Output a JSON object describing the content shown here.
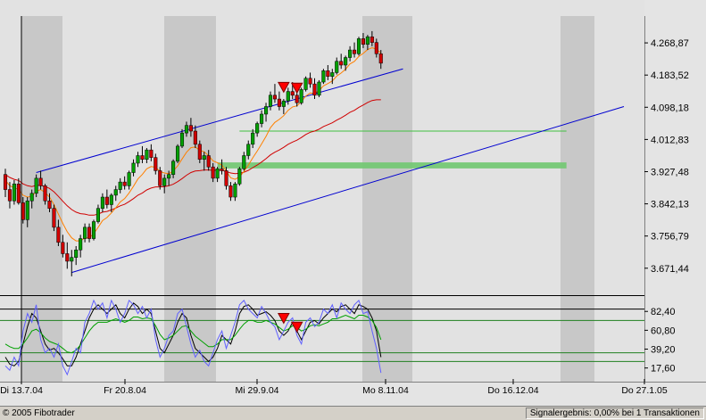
{
  "status": {
    "copyright": "© 2005 Fibotrader",
    "signal": "Signalergebnis: 0,00% bei 1 Transaktionen"
  },
  "chart_data": [
    {
      "type": "candlestick",
      "panel": "price",
      "title": "",
      "y_ticks": [
        "4.268,87",
        "4.183,52",
        "4.098,18",
        "4.012,83",
        "3.927,48",
        "3.842,13",
        "3.756,79",
        "3.671,44"
      ],
      "y_tick_values": [
        4268.87,
        4183.52,
        4098.18,
        4012.83,
        3927.48,
        3842.13,
        3756.79,
        3671.44
      ],
      "ylim": [
        3600,
        4340
      ],
      "x_ticks": [
        "Di 13.7.04",
        "Fr 20.8.04",
        "Mi 29.9.04",
        "Mo 8.11.04",
        "Do 16.12.04",
        "Do 27.1.05"
      ],
      "x_tick_index": [
        0,
        28,
        56,
        84,
        112,
        140
      ],
      "candles": [
        {
          "o": 3920,
          "h": 3935,
          "l": 3860,
          "c": 3880
        },
        {
          "o": 3880,
          "h": 3900,
          "l": 3830,
          "c": 3850
        },
        {
          "o": 3850,
          "h": 3905,
          "l": 3840,
          "c": 3895
        },
        {
          "o": 3895,
          "h": 3910,
          "l": 3840,
          "c": 3845
        },
        {
          "o": 3845,
          "h": 3860,
          "l": 3790,
          "c": 3800
        },
        {
          "o": 3800,
          "h": 3860,
          "l": 3780,
          "c": 3850
        },
        {
          "o": 3850,
          "h": 3880,
          "l": 3830,
          "c": 3870
        },
        {
          "o": 3870,
          "h": 3920,
          "l": 3860,
          "c": 3910
        },
        {
          "o": 3910,
          "h": 3930,
          "l": 3880,
          "c": 3890
        },
        {
          "o": 3890,
          "h": 3895,
          "l": 3840,
          "c": 3850
        },
        {
          "o": 3850,
          "h": 3870,
          "l": 3820,
          "c": 3830
        },
        {
          "o": 3830,
          "h": 3840,
          "l": 3770,
          "c": 3780
        },
        {
          "o": 3780,
          "h": 3800,
          "l": 3730,
          "c": 3740
        },
        {
          "o": 3740,
          "h": 3760,
          "l": 3700,
          "c": 3710
        },
        {
          "o": 3710,
          "h": 3740,
          "l": 3670,
          "c": 3690
        },
        {
          "o": 3690,
          "h": 3720,
          "l": 3650,
          "c": 3700
        },
        {
          "o": 3700,
          "h": 3730,
          "l": 3680,
          "c": 3720
        },
        {
          "o": 3720,
          "h": 3760,
          "l": 3700,
          "c": 3750
        },
        {
          "o": 3750,
          "h": 3790,
          "l": 3740,
          "c": 3780
        },
        {
          "o": 3780,
          "h": 3790,
          "l": 3740,
          "c": 3750
        },
        {
          "o": 3750,
          "h": 3800,
          "l": 3745,
          "c": 3795
        },
        {
          "o": 3795,
          "h": 3840,
          "l": 3790,
          "c": 3830
        },
        {
          "o": 3830,
          "h": 3870,
          "l": 3820,
          "c": 3860
        },
        {
          "o": 3860,
          "h": 3880,
          "l": 3830,
          "c": 3840
        },
        {
          "o": 3840,
          "h": 3870,
          "l": 3820,
          "c": 3865
        },
        {
          "o": 3865,
          "h": 3890,
          "l": 3850,
          "c": 3880
        },
        {
          "o": 3880,
          "h": 3910,
          "l": 3870,
          "c": 3900
        },
        {
          "o": 3900,
          "h": 3915,
          "l": 3880,
          "c": 3890
        },
        {
          "o": 3890,
          "h": 3930,
          "l": 3880,
          "c": 3925
        },
        {
          "o": 3925,
          "h": 3960,
          "l": 3915,
          "c": 3950
        },
        {
          "o": 3950,
          "h": 3980,
          "l": 3940,
          "c": 3970
        },
        {
          "o": 3970,
          "h": 3995,
          "l": 3950,
          "c": 3960
        },
        {
          "o": 3960,
          "h": 3990,
          "l": 3950,
          "c": 3985
        },
        {
          "o": 3985,
          "h": 4000,
          "l": 3955,
          "c": 3965
        },
        {
          "o": 3965,
          "h": 3975,
          "l": 3920,
          "c": 3930
        },
        {
          "o": 3930,
          "h": 3940,
          "l": 3880,
          "c": 3890
        },
        {
          "o": 3890,
          "h": 3920,
          "l": 3870,
          "c": 3910
        },
        {
          "o": 3910,
          "h": 3930,
          "l": 3890,
          "c": 3920
        },
        {
          "o": 3920,
          "h": 3960,
          "l": 3910,
          "c": 3955
        },
        {
          "o": 3955,
          "h": 4000,
          "l": 3950,
          "c": 3995
        },
        {
          "o": 3995,
          "h": 4040,
          "l": 3990,
          "c": 4030
        },
        {
          "o": 4030,
          "h": 4060,
          "l": 4020,
          "c": 4050
        },
        {
          "o": 4050,
          "h": 4070,
          "l": 4020,
          "c": 4035
        },
        {
          "o": 4035,
          "h": 4050,
          "l": 3990,
          "c": 4000
        },
        {
          "o": 4000,
          "h": 4010,
          "l": 3950,
          "c": 3960
        },
        {
          "o": 3960,
          "h": 3980,
          "l": 3930,
          "c": 3970
        },
        {
          "o": 3970,
          "h": 3985,
          "l": 3930,
          "c": 3940
        },
        {
          "o": 3940,
          "h": 3950,
          "l": 3900,
          "c": 3910
        },
        {
          "o": 3910,
          "h": 3940,
          "l": 3900,
          "c": 3935
        },
        {
          "o": 3935,
          "h": 3960,
          "l": 3920,
          "c": 3930
        },
        {
          "o": 3930,
          "h": 3940,
          "l": 3880,
          "c": 3890
        },
        {
          "o": 3890,
          "h": 3900,
          "l": 3850,
          "c": 3860
        },
        {
          "o": 3860,
          "h": 3900,
          "l": 3850,
          "c": 3895
        },
        {
          "o": 3895,
          "h": 3940,
          "l": 3890,
          "c": 3935
        },
        {
          "o": 3935,
          "h": 3980,
          "l": 3930,
          "c": 3970
        },
        {
          "o": 3970,
          "h": 4010,
          "l": 3960,
          "c": 4000
        },
        {
          "o": 4000,
          "h": 4040,
          "l": 3990,
          "c": 4030
        },
        {
          "o": 4030,
          "h": 4060,
          "l": 4020,
          "c": 4055
        },
        {
          "o": 4055,
          "h": 4090,
          "l": 4045,
          "c": 4080
        },
        {
          "o": 4080,
          "h": 4110,
          "l": 4060,
          "c": 4100
        },
        {
          "o": 4100,
          "h": 4140,
          "l": 4090,
          "c": 4130
        },
        {
          "o": 4130,
          "h": 4160,
          "l": 4110,
          "c": 4120
        },
        {
          "o": 4120,
          "h": 4140,
          "l": 4090,
          "c": 4100
        },
        {
          "o": 4100,
          "h": 4120,
          "l": 4080,
          "c": 4115
        },
        {
          "o": 4115,
          "h": 4150,
          "l": 4105,
          "c": 4140
        },
        {
          "o": 4140,
          "h": 4165,
          "l": 4120,
          "c": 4130
        },
        {
          "o": 4130,
          "h": 4150,
          "l": 4100,
          "c": 4110
        },
        {
          "o": 4110,
          "h": 4150,
          "l": 4105,
          "c": 4145
        },
        {
          "o": 4145,
          "h": 4180,
          "l": 4140,
          "c": 4175
        },
        {
          "o": 4175,
          "h": 4190,
          "l": 4150,
          "c": 4160
        },
        {
          "o": 4160,
          "h": 4175,
          "l": 4120,
          "c": 4130
        },
        {
          "o": 4130,
          "h": 4170,
          "l": 4125,
          "c": 4165
        },
        {
          "o": 4165,
          "h": 4200,
          "l": 4160,
          "c": 4195
        },
        {
          "o": 4195,
          "h": 4210,
          "l": 4170,
          "c": 4180
        },
        {
          "o": 4180,
          "h": 4200,
          "l": 4160,
          "c": 4190
        },
        {
          "o": 4190,
          "h": 4230,
          "l": 4185,
          "c": 4220
        },
        {
          "o": 4220,
          "h": 4240,
          "l": 4200,
          "c": 4210
        },
        {
          "o": 4210,
          "h": 4235,
          "l": 4195,
          "c": 4230
        },
        {
          "o": 4230,
          "h": 4260,
          "l": 4220,
          "c": 4250
        },
        {
          "o": 4250,
          "h": 4270,
          "l": 4230,
          "c": 4240
        },
        {
          "o": 4240,
          "h": 4285,
          "l": 4235,
          "c": 4280
        },
        {
          "o": 4280,
          "h": 4295,
          "l": 4255,
          "c": 4265
        },
        {
          "o": 4265,
          "h": 4290,
          "l": 4250,
          "c": 4285
        },
        {
          "o": 4285,
          "h": 4300,
          "l": 4260,
          "c": 4270
        },
        {
          "o": 4270,
          "h": 4280,
          "l": 4230,
          "c": 4240
        },
        {
          "o": 4240,
          "h": 4250,
          "l": 4200,
          "c": 4215
        }
      ],
      "indicators": {
        "ema_fast": [
          3905,
          3890,
          3885,
          3880,
          3865,
          3860,
          3862,
          3875,
          3880,
          3872,
          3860,
          3840,
          3815,
          3790,
          3768,
          3752,
          3744,
          3744,
          3752,
          3752,
          3763,
          3780,
          3798,
          3806,
          3818,
          3832,
          3847,
          3856,
          3871,
          3889,
          3908,
          3920,
          3935,
          3941,
          3939,
          3928,
          3924,
          3922,
          3929,
          3943,
          3961,
          3979,
          3991,
          3993,
          3984,
          3980,
          3970,
          3956,
          3951,
          3945,
          3929,
          3911,
          3907,
          3914,
          3928,
          3945,
          3964,
          3982,
          4001,
          4021,
          4044,
          4058,
          4066,
          4076,
          4090,
          4099,
          4102,
          4113,
          4128,
          4136,
          4135,
          4142,
          4155,
          4161,
          4168,
          4181,
          4189,
          4199,
          4213,
          4220,
          4233,
          4241,
          4251,
          4256,
          4252,
          4242
        ],
        "ema_slow": [
          3920,
          3912,
          3907,
          3904,
          3895,
          3890,
          3888,
          3891,
          3891,
          3888,
          3883,
          3874,
          3862,
          3849,
          3837,
          3827,
          3820,
          3816,
          3815,
          3812,
          3812,
          3815,
          3820,
          3822,
          3826,
          3831,
          3837,
          3841,
          3848,
          3856,
          3865,
          3871,
          3879,
          3884,
          3887,
          3887,
          3888,
          3890,
          3894,
          3901,
          3909,
          3918,
          3925,
          3929,
          3930,
          3932,
          3932,
          3931,
          3931,
          3931,
          3928,
          3924,
          3922,
          3923,
          3926,
          3931,
          3938,
          3945,
          3953,
          3962,
          3972,
          3979,
          3985,
          3992,
          4000,
          4006,
          4011,
          4018,
          4026,
          4032,
          4035,
          4040,
          4047,
          4052,
          4057,
          4064,
          4070,
          4077,
          4085,
          4090,
          4098,
          4104,
          4111,
          4116,
          4118,
          4118
        ]
      },
      "channel": {
        "upper": [
          [
            7,
            3925
          ],
          [
            90,
            4200
          ]
        ],
        "lower": [
          [
            15,
            3660
          ],
          [
            140,
            4100
          ]
        ]
      },
      "hlines": [
        {
          "y": 4035,
          "from": 53,
          "to": 127
        }
      ],
      "green_band": {
        "y_low": 3936,
        "y_high": 3952,
        "from": 48,
        "to": 127
      },
      "sell_signals": [
        {
          "i": 63,
          "y": 4150
        },
        {
          "i": 66,
          "y": 4148
        }
      ],
      "vertical_line_index": 3
    },
    {
      "type": "line",
      "panel": "oscillator",
      "title": "",
      "y_ticks": [
        "82,40",
        "60,80",
        "39,20",
        "17,60"
      ],
      "y_tick_values": [
        82.4,
        60.8,
        39.2,
        17.6
      ],
      "ylim": [
        5,
        100
      ],
      "hlines": [
        85,
        72,
        35,
        25
      ],
      "series": [
        {
          "color": "#000000",
          "values": [
            30,
            22,
            20,
            25,
            45,
            65,
            80,
            75,
            60,
            45,
            38,
            40,
            35,
            28,
            20,
            20,
            30,
            45,
            60,
            75,
            85,
            90,
            85,
            80,
            85,
            90,
            80,
            75,
            85,
            92,
            88,
            80,
            85,
            80,
            60,
            40,
            35,
            45,
            55,
            70,
            80,
            75,
            55,
            40,
            35,
            30,
            25,
            30,
            40,
            55,
            50,
            45,
            60,
            80,
            88,
            90,
            85,
            78,
            80,
            82,
            78,
            72,
            60,
            55,
            60,
            70,
            60,
            50,
            60,
            70,
            72,
            68,
            75,
            80,
            85,
            82,
            88,
            90,
            85,
            80,
            90,
            88,
            85,
            75,
            60,
            30
          ]
        },
        {
          "color": "#00a000",
          "values": [
            45,
            42,
            40,
            40,
            45,
            52,
            60,
            62,
            58,
            52,
            48,
            46,
            44,
            40,
            36,
            35,
            38,
            44,
            52,
            60,
            66,
            70,
            70,
            70,
            72,
            74,
            72,
            70,
            72,
            76,
            76,
            74,
            75,
            74,
            66,
            56,
            50,
            52,
            55,
            60,
            65,
            66,
            60,
            54,
            50,
            46,
            42,
            42,
            45,
            50,
            50,
            50,
            55,
            62,
            68,
            72,
            72,
            70,
            70,
            72,
            70,
            68,
            64,
            60,
            62,
            66,
            64,
            60,
            62,
            66,
            67,
            66,
            68,
            70,
            74,
            74,
            76,
            78,
            76,
            74,
            78,
            78,
            76,
            72,
            64,
            50
          ]
        },
        {
          "color": "#6060ff",
          "values": [
            20,
            15,
            30,
            20,
            60,
            80,
            70,
            90,
            50,
            35,
            40,
            30,
            45,
            20,
            10,
            25,
            40,
            35,
            70,
            80,
            95,
            85,
            92,
            75,
            95,
            85,
            70,
            80,
            95,
            90,
            80,
            88,
            75,
            85,
            50,
            30,
            40,
            55,
            60,
            80,
            85,
            65,
            45,
            30,
            38,
            25,
            20,
            35,
            50,
            60,
            40,
            55,
            70,
            90,
            95,
            85,
            80,
            75,
            88,
            80,
            70,
            65,
            50,
            60,
            70,
            75,
            55,
            45,
            70,
            75,
            65,
            70,
            85,
            80,
            90,
            75,
            92,
            85,
            80,
            90,
            95,
            80,
            82,
            60,
            40,
            12
          ]
        }
      ],
      "sell_signals": [
        {
          "i": 63,
          "y": 74
        },
        {
          "i": 66,
          "y": 64
        }
      ]
    }
  ]
}
